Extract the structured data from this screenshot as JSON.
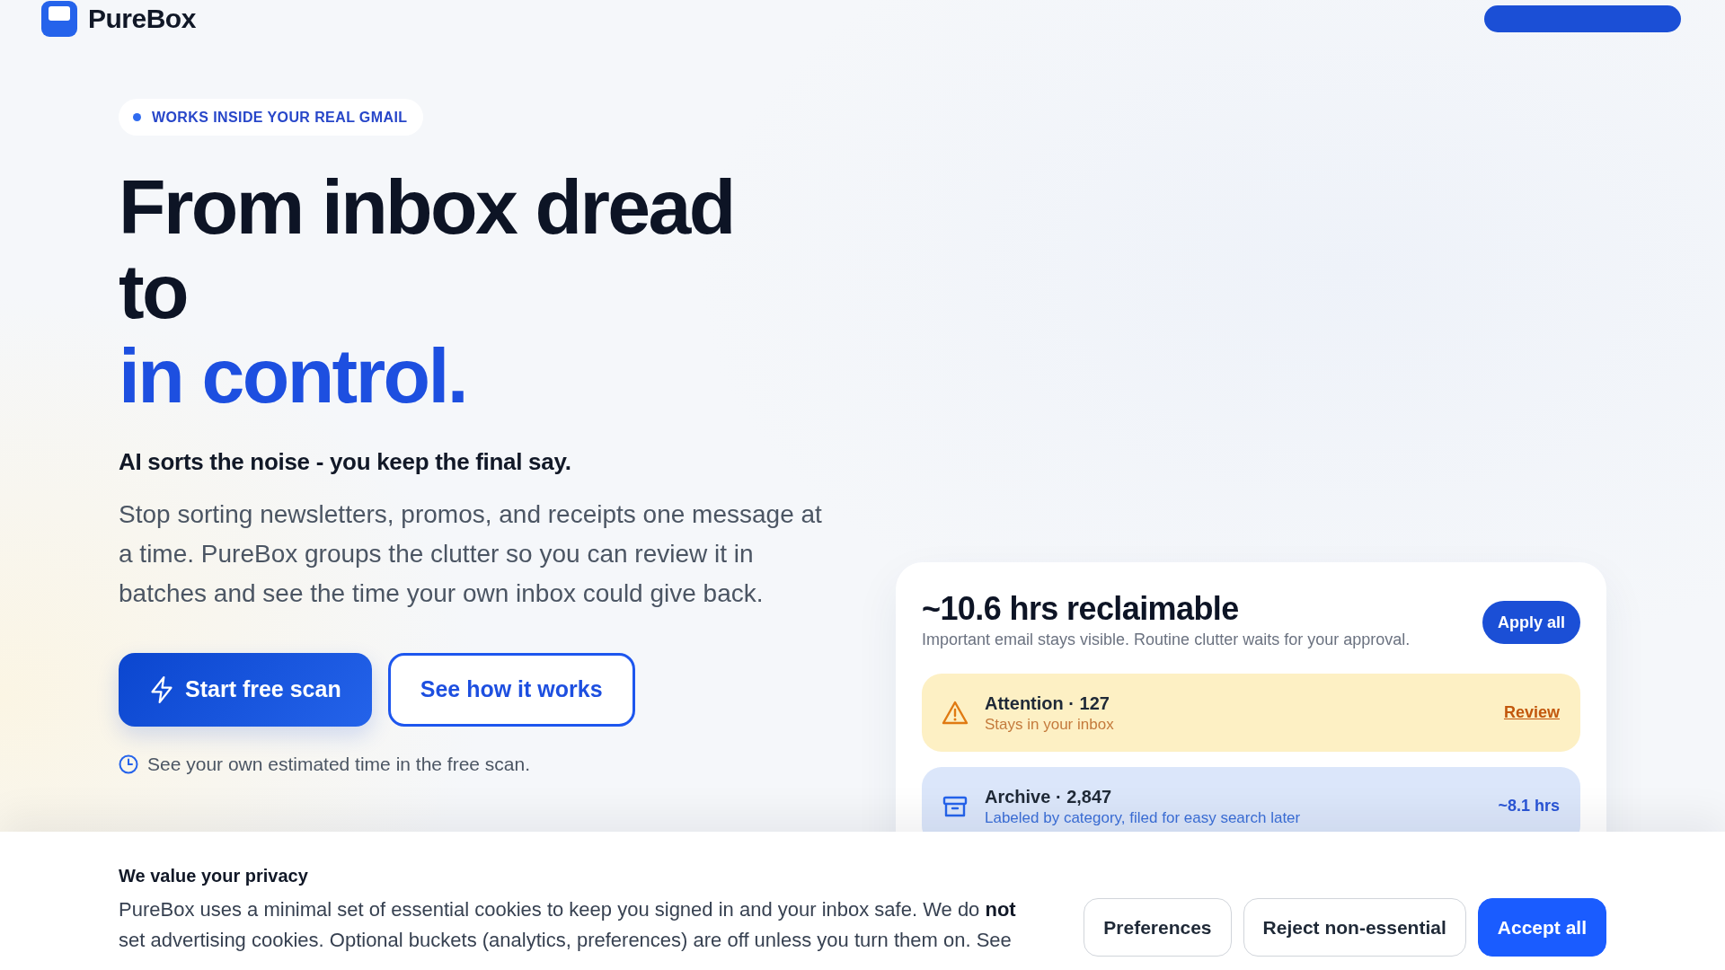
{
  "header": {
    "logo_text": "PureBox",
    "cta": {
      "kind": "primary"
    }
  },
  "hero": {
    "badge": "WORKS INSIDE YOUR REAL GMAIL",
    "headline": "From inbox dread to",
    "headline_accent": "in control.",
    "tagline": "AI sorts the noise - you keep the final say.",
    "description": "Stop sorting newsletters, promos, and receipts one message at a time. PureBox groups the clutter so you can review it in batches and see the time your own inbox could give back.",
    "buttons": [
      {
        "kind": "primary",
        "label": "Start free scan"
      },
      {
        "kind": "outline",
        "label": "See how it works"
      }
    ],
    "note": "See your own estimated time in the free scan."
  },
  "summary_card": {
    "title": "~10.6 hrs reclaimable",
    "subtitle": "Important email stays visible. Routine clutter waits for your approval.",
    "action": "Apply all",
    "groups": [
      {
        "kind": "attention",
        "title": "Attention · 127",
        "subtitle": "Stays in your inbox",
        "trailing": {
          "kind": "link",
          "text": "Review"
        }
      },
      {
        "kind": "archive",
        "title": "Archive · 2,847",
        "subtitle": "Labeled by category, filed for easy search later",
        "trailing": {
          "kind": "estimate",
          "text": "~8.1 hrs"
        }
      }
    ]
  },
  "cookie_banner": {
    "title": "We value your privacy",
    "text": "PureBox uses a minimal set of essential cookies to keep you signed in and your inbox safe. We do **not** set advertising cookies. Optional buckets (analytics, preferences) are off unless you turn them on. See",
    "buttons": [
      {
        "kind": "secondary",
        "label": "Preferences"
      },
      {
        "kind": "secondary",
        "label": "Reject non-essential"
      },
      {
        "kind": "primary",
        "label": "Accept all"
      }
    ]
  }
}
